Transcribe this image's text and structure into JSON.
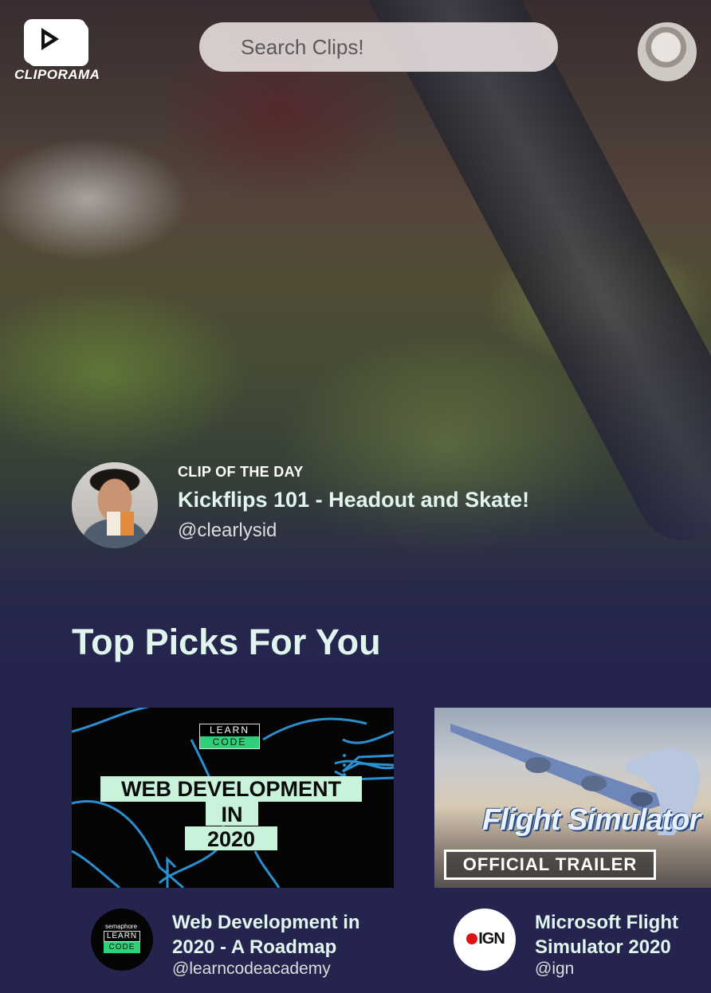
{
  "app": {
    "logo_text": "CLIPORAMA"
  },
  "search": {
    "placeholder": "Search Clips!"
  },
  "featured": {
    "label": "CLIP OF THE DAY",
    "title": "Kickflips 101 - Headout and Skate!",
    "handle": "@clearlysid"
  },
  "section": {
    "title": "Top Picks For You"
  },
  "picks": [
    {
      "title": "Web Development in 2020 - A Roadmap",
      "handle": "@learncodeacademy",
      "thumb_badge_top": "LEARN",
      "thumb_badge_bottom": "CODE",
      "thumb_line_1": "WEB DEVELOPMENT",
      "thumb_line_2": "IN",
      "thumb_line_3": "2020",
      "avatar_small": "semaphore",
      "avatar_top": "LEARN",
      "avatar_bottom": "CODE"
    },
    {
      "title": "Microsoft Flight Simulator 2020",
      "handle": "@ign",
      "thumb_brand": "Flight Simulator",
      "thumb_caption": "OFFICIAL TRAILER",
      "avatar_text": "IGN"
    }
  ],
  "colors": {
    "background": "#24244f",
    "title_text": "#dff5ee",
    "learncode_green": "#2ed07a"
  }
}
